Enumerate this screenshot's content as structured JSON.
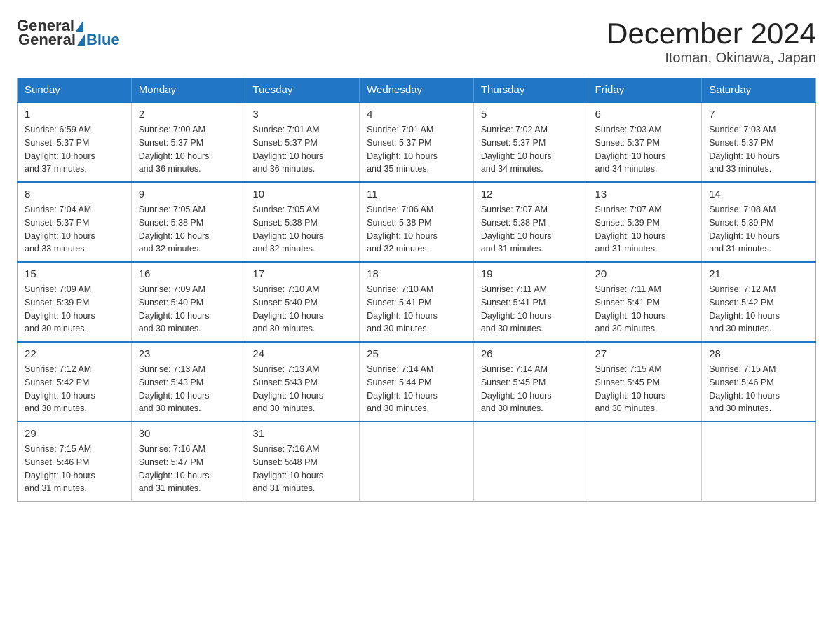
{
  "header": {
    "logo_general": "General",
    "logo_blue": "Blue",
    "title": "December 2024",
    "location": "Itoman, Okinawa, Japan"
  },
  "days_of_week": [
    "Sunday",
    "Monday",
    "Tuesday",
    "Wednesday",
    "Thursday",
    "Friday",
    "Saturday"
  ],
  "weeks": [
    [
      {
        "day": "1",
        "sunrise": "6:59 AM",
        "sunset": "5:37 PM",
        "daylight": "10 hours and 37 minutes."
      },
      {
        "day": "2",
        "sunrise": "7:00 AM",
        "sunset": "5:37 PM",
        "daylight": "10 hours and 36 minutes."
      },
      {
        "day": "3",
        "sunrise": "7:01 AM",
        "sunset": "5:37 PM",
        "daylight": "10 hours and 36 minutes."
      },
      {
        "day": "4",
        "sunrise": "7:01 AM",
        "sunset": "5:37 PM",
        "daylight": "10 hours and 35 minutes."
      },
      {
        "day": "5",
        "sunrise": "7:02 AM",
        "sunset": "5:37 PM",
        "daylight": "10 hours and 34 minutes."
      },
      {
        "day": "6",
        "sunrise": "7:03 AM",
        "sunset": "5:37 PM",
        "daylight": "10 hours and 34 minutes."
      },
      {
        "day": "7",
        "sunrise": "7:03 AM",
        "sunset": "5:37 PM",
        "daylight": "10 hours and 33 minutes."
      }
    ],
    [
      {
        "day": "8",
        "sunrise": "7:04 AM",
        "sunset": "5:37 PM",
        "daylight": "10 hours and 33 minutes."
      },
      {
        "day": "9",
        "sunrise": "7:05 AM",
        "sunset": "5:38 PM",
        "daylight": "10 hours and 32 minutes."
      },
      {
        "day": "10",
        "sunrise": "7:05 AM",
        "sunset": "5:38 PM",
        "daylight": "10 hours and 32 minutes."
      },
      {
        "day": "11",
        "sunrise": "7:06 AM",
        "sunset": "5:38 PM",
        "daylight": "10 hours and 32 minutes."
      },
      {
        "day": "12",
        "sunrise": "7:07 AM",
        "sunset": "5:38 PM",
        "daylight": "10 hours and 31 minutes."
      },
      {
        "day": "13",
        "sunrise": "7:07 AM",
        "sunset": "5:39 PM",
        "daylight": "10 hours and 31 minutes."
      },
      {
        "day": "14",
        "sunrise": "7:08 AM",
        "sunset": "5:39 PM",
        "daylight": "10 hours and 31 minutes."
      }
    ],
    [
      {
        "day": "15",
        "sunrise": "7:09 AM",
        "sunset": "5:39 PM",
        "daylight": "10 hours and 30 minutes."
      },
      {
        "day": "16",
        "sunrise": "7:09 AM",
        "sunset": "5:40 PM",
        "daylight": "10 hours and 30 minutes."
      },
      {
        "day": "17",
        "sunrise": "7:10 AM",
        "sunset": "5:40 PM",
        "daylight": "10 hours and 30 minutes."
      },
      {
        "day": "18",
        "sunrise": "7:10 AM",
        "sunset": "5:41 PM",
        "daylight": "10 hours and 30 minutes."
      },
      {
        "day": "19",
        "sunrise": "7:11 AM",
        "sunset": "5:41 PM",
        "daylight": "10 hours and 30 minutes."
      },
      {
        "day": "20",
        "sunrise": "7:11 AM",
        "sunset": "5:41 PM",
        "daylight": "10 hours and 30 minutes."
      },
      {
        "day": "21",
        "sunrise": "7:12 AM",
        "sunset": "5:42 PM",
        "daylight": "10 hours and 30 minutes."
      }
    ],
    [
      {
        "day": "22",
        "sunrise": "7:12 AM",
        "sunset": "5:42 PM",
        "daylight": "10 hours and 30 minutes."
      },
      {
        "day": "23",
        "sunrise": "7:13 AM",
        "sunset": "5:43 PM",
        "daylight": "10 hours and 30 minutes."
      },
      {
        "day": "24",
        "sunrise": "7:13 AM",
        "sunset": "5:43 PM",
        "daylight": "10 hours and 30 minutes."
      },
      {
        "day": "25",
        "sunrise": "7:14 AM",
        "sunset": "5:44 PM",
        "daylight": "10 hours and 30 minutes."
      },
      {
        "day": "26",
        "sunrise": "7:14 AM",
        "sunset": "5:45 PM",
        "daylight": "10 hours and 30 minutes."
      },
      {
        "day": "27",
        "sunrise": "7:15 AM",
        "sunset": "5:45 PM",
        "daylight": "10 hours and 30 minutes."
      },
      {
        "day": "28",
        "sunrise": "7:15 AM",
        "sunset": "5:46 PM",
        "daylight": "10 hours and 30 minutes."
      }
    ],
    [
      {
        "day": "29",
        "sunrise": "7:15 AM",
        "sunset": "5:46 PM",
        "daylight": "10 hours and 31 minutes."
      },
      {
        "day": "30",
        "sunrise": "7:16 AM",
        "sunset": "5:47 PM",
        "daylight": "10 hours and 31 minutes."
      },
      {
        "day": "31",
        "sunrise": "7:16 AM",
        "sunset": "5:48 PM",
        "daylight": "10 hours and 31 minutes."
      },
      null,
      null,
      null,
      null
    ]
  ],
  "labels": {
    "sunrise": "Sunrise:",
    "sunset": "Sunset:",
    "daylight": "Daylight:"
  }
}
